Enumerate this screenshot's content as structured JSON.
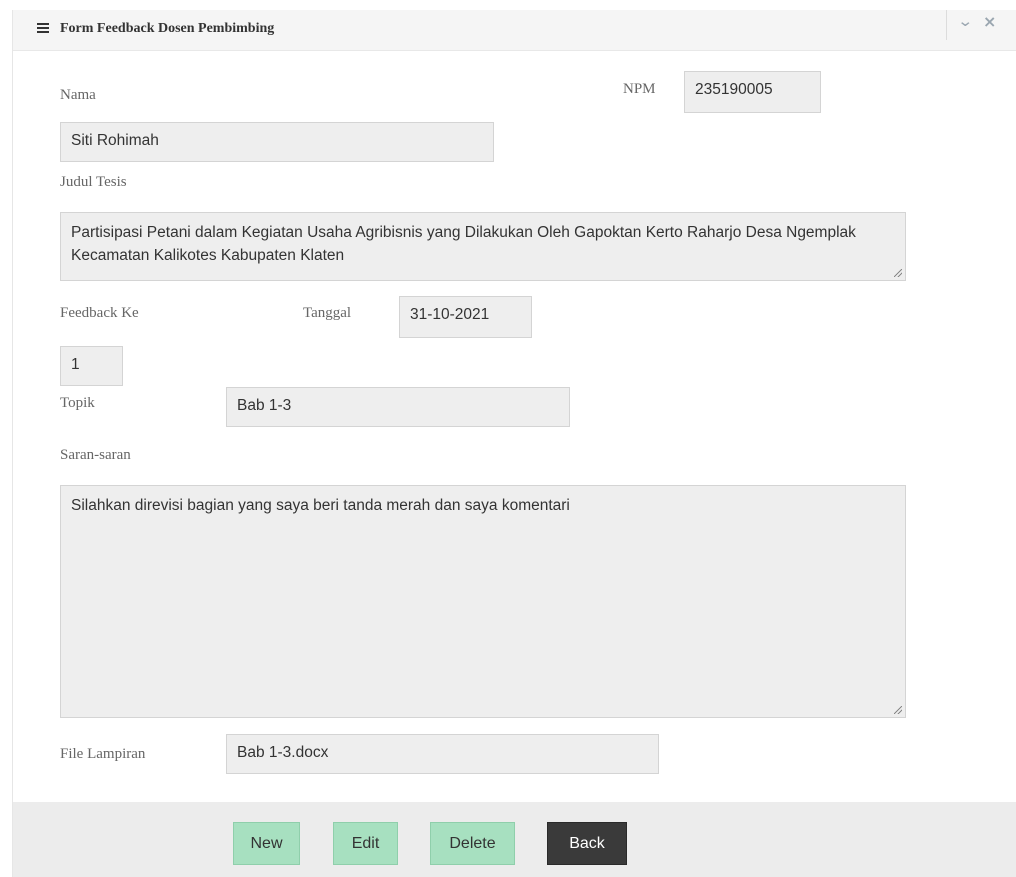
{
  "header": {
    "menu_icon": "hamburger-menu-icon",
    "title": "Form Feedback Dosen Pembimbing",
    "collapse_icon": "chevron-down-icon",
    "close_icon": "close-icon"
  },
  "form": {
    "nama_label": "Nama",
    "nama_value": "Siti Rohimah",
    "npm_label": "NPM",
    "npm_value": "235190005",
    "judul_label": "Judul Tesis",
    "judul_value": "Partisipasi Petani dalam Kegiatan Usaha Agribisnis yang Dilakukan Oleh Gapoktan Kerto Raharjo Desa Ngemplak Kecamatan Kalikotes Kabupaten Klaten",
    "feedback_label": "Feedback Ke",
    "feedback_value": "1",
    "tanggal_label": "Tanggal",
    "tanggal_value": "31-10-2021",
    "topik_label": "Topik",
    "topik_value": "Bab 1-3",
    "saran_label": "Saran-saran",
    "saran_value": "Silahkan direvisi bagian yang saya beri tanda merah dan saya komentari",
    "file_label": "File Lampiran",
    "file_value": "Bab 1-3.docx"
  },
  "buttons": {
    "new": "New",
    "edit": "Edit",
    "delete": "Delete",
    "back": "Back"
  },
  "colors": {
    "button_green": "#a7e0c0",
    "button_dark": "#3a3a3a",
    "field_bg": "#eeeeee"
  }
}
